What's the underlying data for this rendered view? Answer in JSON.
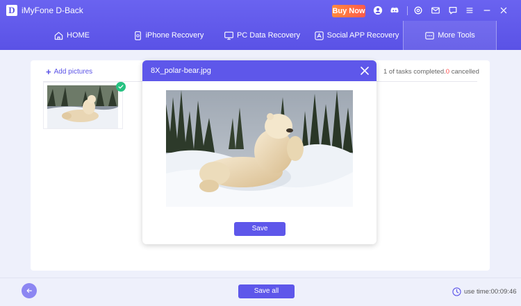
{
  "app": {
    "title": "iMyFone D-Back",
    "logo_letter": "D",
    "buy_now": "Buy Now"
  },
  "titlebar_icons": [
    "account-icon",
    "discord-icon",
    "settings-icon",
    "mail-icon",
    "feedback-icon",
    "menu-icon",
    "minimize-icon",
    "close-icon"
  ],
  "nav": {
    "items": [
      {
        "label": "HOME",
        "icon": "home-icon"
      },
      {
        "label": "iPhone Recovery",
        "icon": "iphone-icon"
      },
      {
        "label": "PC Data Recovery",
        "icon": "monitor-icon"
      },
      {
        "label": "Social APP Recovery",
        "icon": "social-app-icon"
      },
      {
        "label": "More Tools",
        "icon": "more-tools-icon"
      }
    ],
    "active_index": 4
  },
  "main": {
    "add_pictures": "Add pictures",
    "task_status_prefix": "1 of tasks completed.",
    "cancelled_count": "0",
    "cancelled_label": " cancelled"
  },
  "dialog": {
    "title": "8X_polar-bear.jpg",
    "save_label": "Save"
  },
  "zoom_tools": [
    "fullscreen-icon",
    "zoom-in-icon",
    "zoom-out-icon",
    "rotate-left-icon",
    "rotate-right-icon"
  ],
  "footer": {
    "save_all": "Save all",
    "use_time_label": "use time:",
    "use_time_value": "00:09:46"
  },
  "colors": {
    "accent": "#5e57ea",
    "buy_now": "#ff6a42",
    "success": "#26c281",
    "cancelled": "#ff4d4d"
  }
}
